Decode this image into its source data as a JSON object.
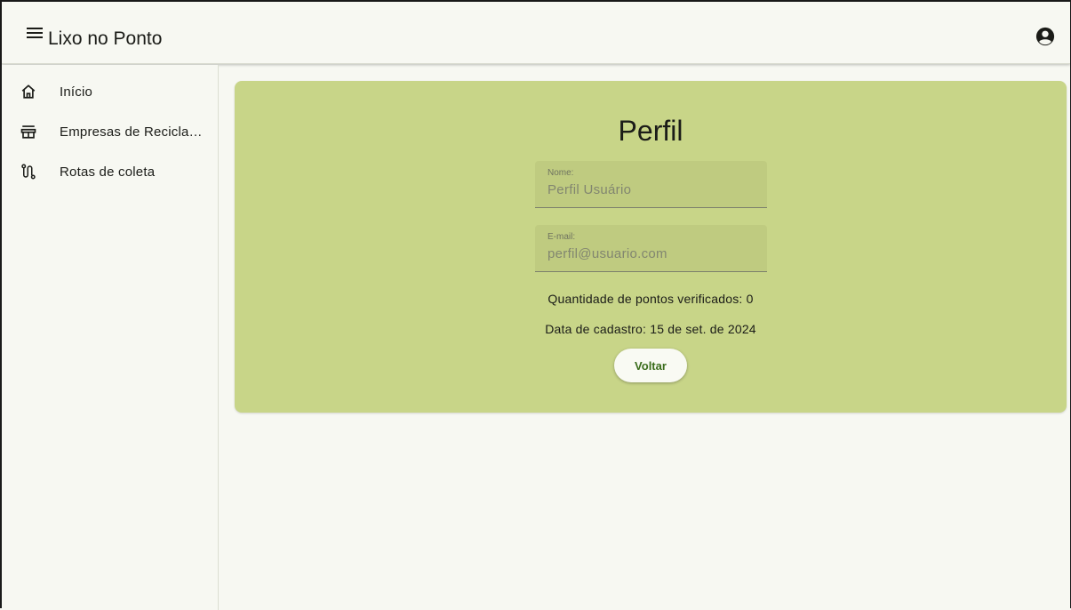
{
  "app": {
    "title": "Lixo no Ponto"
  },
  "header": {
    "menu_icon": "menu-icon",
    "account_icon": "account-circle-icon"
  },
  "sidebar": {
    "items": [
      {
        "label": "Início",
        "icon": "home-icon"
      },
      {
        "label": "Empresas de Recicla…",
        "icon": "store-icon"
      },
      {
        "label": "Rotas de coleta",
        "icon": "route-icon"
      }
    ]
  },
  "profile": {
    "title": "Perfil",
    "name_label": "Nome:",
    "name_value": "Perfil Usuário",
    "email_label": "E-mail:",
    "email_value": "perfil@usuario.com",
    "points_text": "Quantidade de pontos verificados: 0",
    "signup_text": "Data de cadastro: 15 de set. de 2024",
    "back_label": "Voltar"
  },
  "colors": {
    "background": "#f7f8f2",
    "card": "#c8d588",
    "field": "#bfcb80",
    "button_text": "#3b6d1c"
  }
}
